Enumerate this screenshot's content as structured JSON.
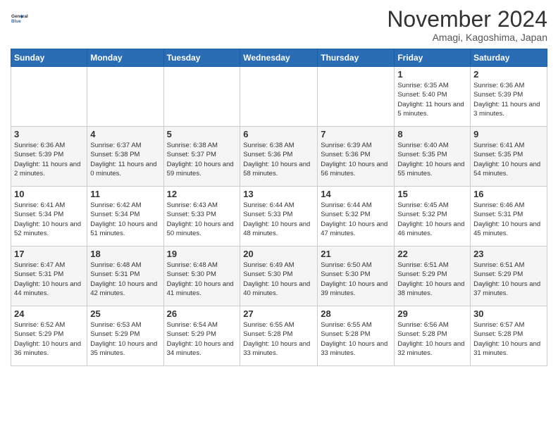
{
  "logo": {
    "line1": "General",
    "line2": "Blue"
  },
  "title": "November 2024",
  "location": "Amagi, Kagoshima, Japan",
  "weekdays": [
    "Sunday",
    "Monday",
    "Tuesday",
    "Wednesday",
    "Thursday",
    "Friday",
    "Saturday"
  ],
  "weeks": [
    [
      {
        "day": "",
        "sunrise": "",
        "sunset": "",
        "daylight": ""
      },
      {
        "day": "",
        "sunrise": "",
        "sunset": "",
        "daylight": ""
      },
      {
        "day": "",
        "sunrise": "",
        "sunset": "",
        "daylight": ""
      },
      {
        "day": "",
        "sunrise": "",
        "sunset": "",
        "daylight": ""
      },
      {
        "day": "",
        "sunrise": "",
        "sunset": "",
        "daylight": ""
      },
      {
        "day": "1",
        "sunrise": "Sunrise: 6:35 AM",
        "sunset": "Sunset: 5:40 PM",
        "daylight": "Daylight: 11 hours and 5 minutes."
      },
      {
        "day": "2",
        "sunrise": "Sunrise: 6:36 AM",
        "sunset": "Sunset: 5:39 PM",
        "daylight": "Daylight: 11 hours and 3 minutes."
      }
    ],
    [
      {
        "day": "3",
        "sunrise": "Sunrise: 6:36 AM",
        "sunset": "Sunset: 5:39 PM",
        "daylight": "Daylight: 11 hours and 2 minutes."
      },
      {
        "day": "4",
        "sunrise": "Sunrise: 6:37 AM",
        "sunset": "Sunset: 5:38 PM",
        "daylight": "Daylight: 11 hours and 0 minutes."
      },
      {
        "day": "5",
        "sunrise": "Sunrise: 6:38 AM",
        "sunset": "Sunset: 5:37 PM",
        "daylight": "Daylight: 10 hours and 59 minutes."
      },
      {
        "day": "6",
        "sunrise": "Sunrise: 6:38 AM",
        "sunset": "Sunset: 5:36 PM",
        "daylight": "Daylight: 10 hours and 58 minutes."
      },
      {
        "day": "7",
        "sunrise": "Sunrise: 6:39 AM",
        "sunset": "Sunset: 5:36 PM",
        "daylight": "Daylight: 10 hours and 56 minutes."
      },
      {
        "day": "8",
        "sunrise": "Sunrise: 6:40 AM",
        "sunset": "Sunset: 5:35 PM",
        "daylight": "Daylight: 10 hours and 55 minutes."
      },
      {
        "day": "9",
        "sunrise": "Sunrise: 6:41 AM",
        "sunset": "Sunset: 5:35 PM",
        "daylight": "Daylight: 10 hours and 54 minutes."
      }
    ],
    [
      {
        "day": "10",
        "sunrise": "Sunrise: 6:41 AM",
        "sunset": "Sunset: 5:34 PM",
        "daylight": "Daylight: 10 hours and 52 minutes."
      },
      {
        "day": "11",
        "sunrise": "Sunrise: 6:42 AM",
        "sunset": "Sunset: 5:34 PM",
        "daylight": "Daylight: 10 hours and 51 minutes."
      },
      {
        "day": "12",
        "sunrise": "Sunrise: 6:43 AM",
        "sunset": "Sunset: 5:33 PM",
        "daylight": "Daylight: 10 hours and 50 minutes."
      },
      {
        "day": "13",
        "sunrise": "Sunrise: 6:44 AM",
        "sunset": "Sunset: 5:33 PM",
        "daylight": "Daylight: 10 hours and 48 minutes."
      },
      {
        "day": "14",
        "sunrise": "Sunrise: 6:44 AM",
        "sunset": "Sunset: 5:32 PM",
        "daylight": "Daylight: 10 hours and 47 minutes."
      },
      {
        "day": "15",
        "sunrise": "Sunrise: 6:45 AM",
        "sunset": "Sunset: 5:32 PM",
        "daylight": "Daylight: 10 hours and 46 minutes."
      },
      {
        "day": "16",
        "sunrise": "Sunrise: 6:46 AM",
        "sunset": "Sunset: 5:31 PM",
        "daylight": "Daylight: 10 hours and 45 minutes."
      }
    ],
    [
      {
        "day": "17",
        "sunrise": "Sunrise: 6:47 AM",
        "sunset": "Sunset: 5:31 PM",
        "daylight": "Daylight: 10 hours and 44 minutes."
      },
      {
        "day": "18",
        "sunrise": "Sunrise: 6:48 AM",
        "sunset": "Sunset: 5:31 PM",
        "daylight": "Daylight: 10 hours and 42 minutes."
      },
      {
        "day": "19",
        "sunrise": "Sunrise: 6:48 AM",
        "sunset": "Sunset: 5:30 PM",
        "daylight": "Daylight: 10 hours and 41 minutes."
      },
      {
        "day": "20",
        "sunrise": "Sunrise: 6:49 AM",
        "sunset": "Sunset: 5:30 PM",
        "daylight": "Daylight: 10 hours and 40 minutes."
      },
      {
        "day": "21",
        "sunrise": "Sunrise: 6:50 AM",
        "sunset": "Sunset: 5:30 PM",
        "daylight": "Daylight: 10 hours and 39 minutes."
      },
      {
        "day": "22",
        "sunrise": "Sunrise: 6:51 AM",
        "sunset": "Sunset: 5:29 PM",
        "daylight": "Daylight: 10 hours and 38 minutes."
      },
      {
        "day": "23",
        "sunrise": "Sunrise: 6:51 AM",
        "sunset": "Sunset: 5:29 PM",
        "daylight": "Daylight: 10 hours and 37 minutes."
      }
    ],
    [
      {
        "day": "24",
        "sunrise": "Sunrise: 6:52 AM",
        "sunset": "Sunset: 5:29 PM",
        "daylight": "Daylight: 10 hours and 36 minutes."
      },
      {
        "day": "25",
        "sunrise": "Sunrise: 6:53 AM",
        "sunset": "Sunset: 5:29 PM",
        "daylight": "Daylight: 10 hours and 35 minutes."
      },
      {
        "day": "26",
        "sunrise": "Sunrise: 6:54 AM",
        "sunset": "Sunset: 5:29 PM",
        "daylight": "Daylight: 10 hours and 34 minutes."
      },
      {
        "day": "27",
        "sunrise": "Sunrise: 6:55 AM",
        "sunset": "Sunset: 5:28 PM",
        "daylight": "Daylight: 10 hours and 33 minutes."
      },
      {
        "day": "28",
        "sunrise": "Sunrise: 6:55 AM",
        "sunset": "Sunset: 5:28 PM",
        "daylight": "Daylight: 10 hours and 33 minutes."
      },
      {
        "day": "29",
        "sunrise": "Sunrise: 6:56 AM",
        "sunset": "Sunset: 5:28 PM",
        "daylight": "Daylight: 10 hours and 32 minutes."
      },
      {
        "day": "30",
        "sunrise": "Sunrise: 6:57 AM",
        "sunset": "Sunset: 5:28 PM",
        "daylight": "Daylight: 10 hours and 31 minutes."
      }
    ]
  ]
}
